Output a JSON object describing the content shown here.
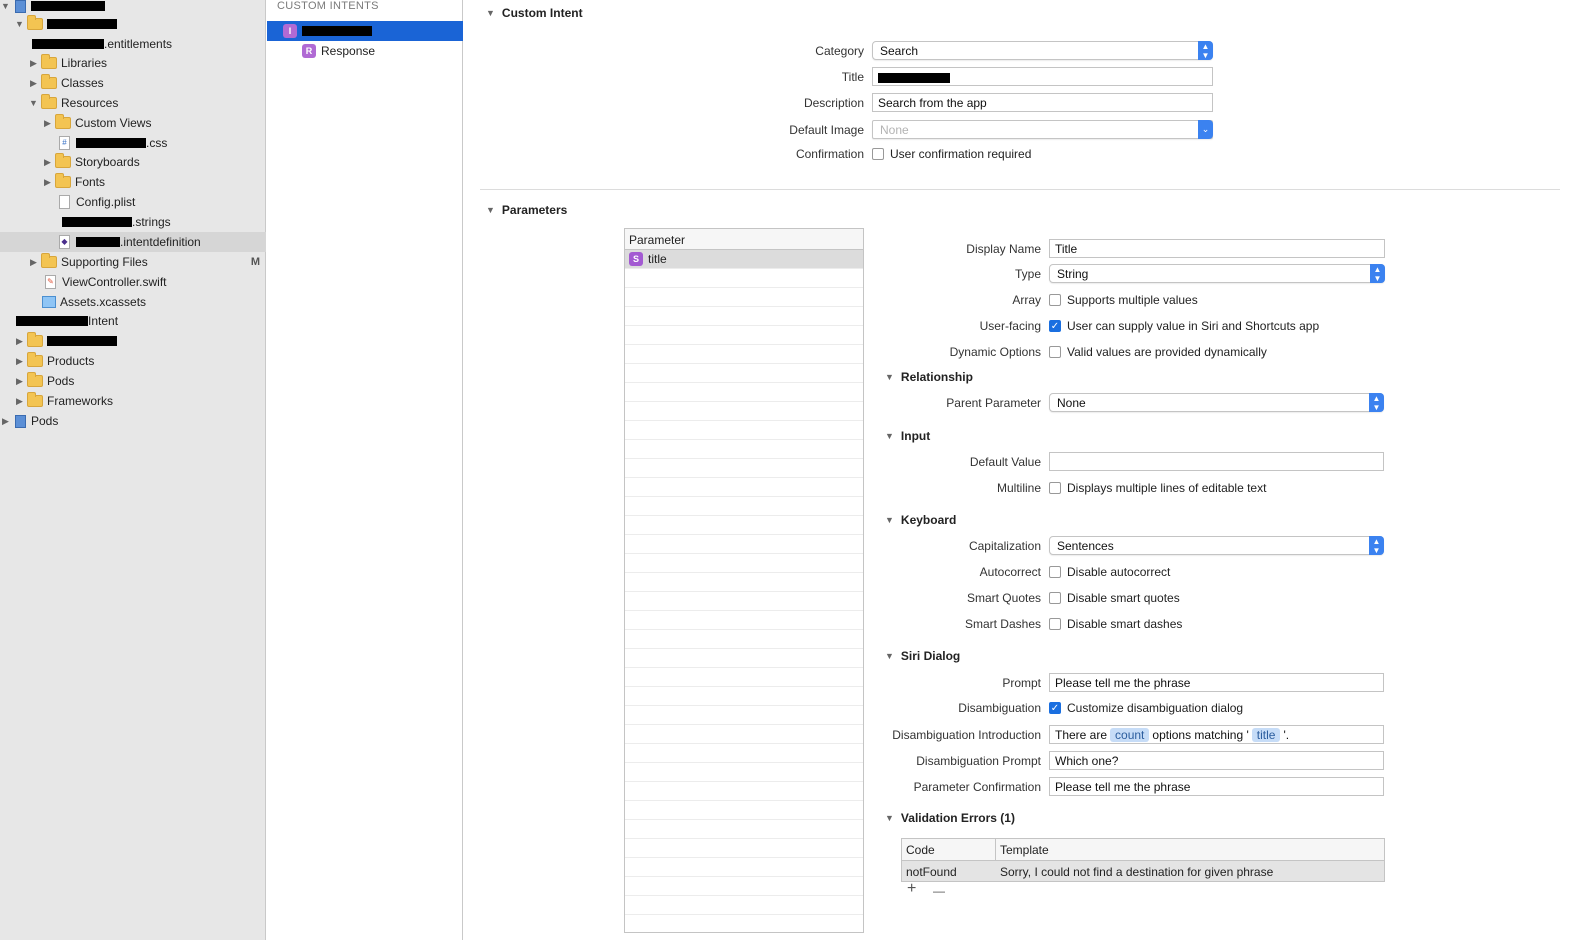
{
  "navigator": {
    "rows": [
      {
        "label": ""
      },
      {
        "label": ""
      },
      {
        "label": ".entitlements"
      },
      {
        "label": "Libraries"
      },
      {
        "label": "Classes"
      },
      {
        "label": "Resources"
      },
      {
        "label": "Custom Views"
      },
      {
        "label": ".css"
      },
      {
        "label": "Storyboards"
      },
      {
        "label": "Fonts"
      },
      {
        "label": "Config.plist"
      },
      {
        "label": ".strings"
      },
      {
        "label": ".intentdefinition"
      },
      {
        "label": "Supporting Files",
        "badge": "M"
      },
      {
        "label": "ViewController.swift"
      },
      {
        "label": "Assets.xcassets"
      },
      {
        "label": "Intent"
      },
      {
        "label": ""
      },
      {
        "label": "Products"
      },
      {
        "label": "Pods"
      },
      {
        "label": "Frameworks"
      },
      {
        "label": "Pods"
      }
    ]
  },
  "intent_list": {
    "header": "CUSTOM INTENTS",
    "intent_tag": "I",
    "response_tag": "R",
    "response_label": "Response"
  },
  "custom_intent": {
    "header": "Custom Intent",
    "category_label": "Category",
    "category_value": "Search",
    "title_label": "Title",
    "description_label": "Description",
    "description_value": "Search from the app",
    "default_image_label": "Default Image",
    "default_image_value": "None",
    "confirmation_label": "Confirmation",
    "confirmation_text": "User confirmation required"
  },
  "parameters": {
    "header": "Parameters",
    "table_header": "Parameter",
    "param_tag": "S",
    "param_name": "title",
    "display_name_label": "Display Name",
    "display_name_value": "Title",
    "type_label": "Type",
    "type_value": "String",
    "array_label": "Array",
    "array_text": "Supports multiple values",
    "user_facing_label": "User-facing",
    "user_facing_text": "User can supply value in Siri and Shortcuts app",
    "dynamic_label": "Dynamic Options",
    "dynamic_text": "Valid values are provided dynamically"
  },
  "relationship": {
    "header": "Relationship",
    "parent_label": "Parent Parameter",
    "parent_value": "None"
  },
  "input": {
    "header": "Input",
    "default_label": "Default Value",
    "multiline_label": "Multiline",
    "multiline_text": "Displays multiple lines of editable text"
  },
  "keyboard": {
    "header": "Keyboard",
    "cap_label": "Capitalization",
    "cap_value": "Sentences",
    "autocorrect_label": "Autocorrect",
    "autocorrect_text": "Disable autocorrect",
    "quotes_label": "Smart Quotes",
    "quotes_text": "Disable smart quotes",
    "dashes_label": "Smart Dashes",
    "dashes_text": "Disable smart dashes"
  },
  "siri_dialog": {
    "header": "Siri Dialog",
    "prompt_label": "Prompt",
    "prompt_value": "Please tell me the phrase",
    "disamb_label": "Disambiguation",
    "disamb_text": "Customize disambiguation dialog",
    "intro_label": "Disambiguation Introduction",
    "intro_part1": "There are",
    "intro_token1": "count",
    "intro_part2": "options matching '",
    "intro_token2": "title",
    "intro_part3": "'.",
    "disamb_prompt_label": "Disambiguation Prompt",
    "disamb_prompt_value": "Which one?",
    "confirm_label": "Parameter Confirmation",
    "confirm_value": "Please tell me the phrase"
  },
  "validation": {
    "header": "Validation Errors (1)",
    "col_code": "Code",
    "col_template": "Template",
    "rows": [
      {
        "code": "notFound",
        "template": "Sorry, I could not find a destination for given phrase"
      }
    ],
    "add_label": "+",
    "remove_label": "—"
  }
}
